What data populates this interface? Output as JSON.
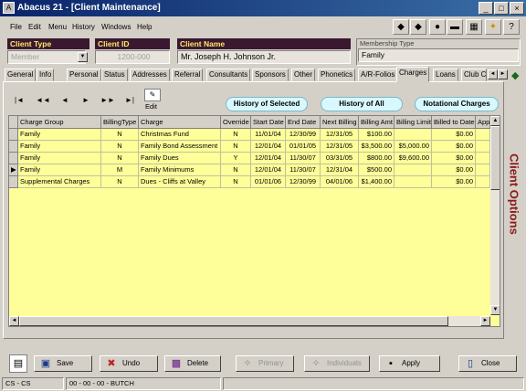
{
  "window": {
    "title": "Abacus 21 - [Client Maintenance]"
  },
  "menu": [
    "File",
    "Edit",
    "Menu",
    "History",
    "Windows",
    "Help"
  ],
  "header": {
    "client_type_label": "Client Type",
    "client_type_value": "Member",
    "client_id_label": "Client ID",
    "client_id_value": "1200-000",
    "client_name_label": "Client Name",
    "client_name_value": "Mr. Joseph H. Johnson Jr.",
    "membership_type_label": "Membership Type",
    "membership_type_value": "Family"
  },
  "tabs": [
    "General",
    "Info",
    "Personal",
    "Status",
    "Addresses",
    "Referral",
    "Consultants",
    "Sponsors",
    "Other",
    "Phonetics",
    "A/R-Folios",
    "Charges",
    "Loans",
    "Club C"
  ],
  "active_tab": "Charges",
  "toolbar": {
    "edit_label": "Edit"
  },
  "actions": {
    "history_selected": "History of Selected",
    "history_all": "History of All",
    "notational": "Notational Charges"
  },
  "grid": {
    "columns": [
      "Charge Group",
      "BillingType",
      "Charge",
      "Override",
      "Start Date",
      "End Date",
      "Next Billing",
      "Billing Amt",
      "Billing Limit",
      "Billed to Date",
      "App"
    ],
    "rows": [
      [
        "Family",
        "N",
        "Christmas Fund",
        "N",
        "11/01/04",
        "12/30/99",
        "12/31/05",
        "$100.00",
        "",
        "$0.00",
        ""
      ],
      [
        "Family",
        "N",
        "Family Bond Assessment",
        "N",
        "12/01/04",
        "01/01/05",
        "12/31/05",
        "$3,500.00",
        "$5,000.00",
        "$0.00",
        ""
      ],
      [
        "Family",
        "N",
        "Family Dues",
        "Y",
        "12/01/04",
        "11/30/07",
        "03/31/05",
        "$800.00",
        "$9,600.00",
        "$0.00",
        ""
      ],
      [
        "Family",
        "M",
        "Family Minimums",
        "N",
        "12/01/04",
        "11/30/07",
        "12/31/04",
        "$500.00",
        "",
        "$0.00",
        ""
      ],
      [
        "Supplemental Charges",
        "N",
        "Dues - Cliffs at Valley",
        "N",
        "01/01/06",
        "12/30/99",
        "04/01/06",
        "$1,400.00",
        "",
        "$0.00",
        ""
      ]
    ],
    "selected_row": 3
  },
  "side_label": "Client Options",
  "buttons": {
    "save": "Save",
    "undo": "Undo",
    "delete": "Delete",
    "primary": "Primary",
    "individuals": "Individuals",
    "apply": "Apply",
    "close": "Close"
  },
  "status": {
    "left": "CS - CS",
    "middle": "00 - 00 - 00 - BUTCH"
  },
  "colors": {
    "grid_background": "#ffff99",
    "header_label_bg": "#3a1830",
    "header_label_fg": "#ffe860",
    "side_label": "#8b1a1a",
    "pill_bg": "#d8f8ff"
  }
}
